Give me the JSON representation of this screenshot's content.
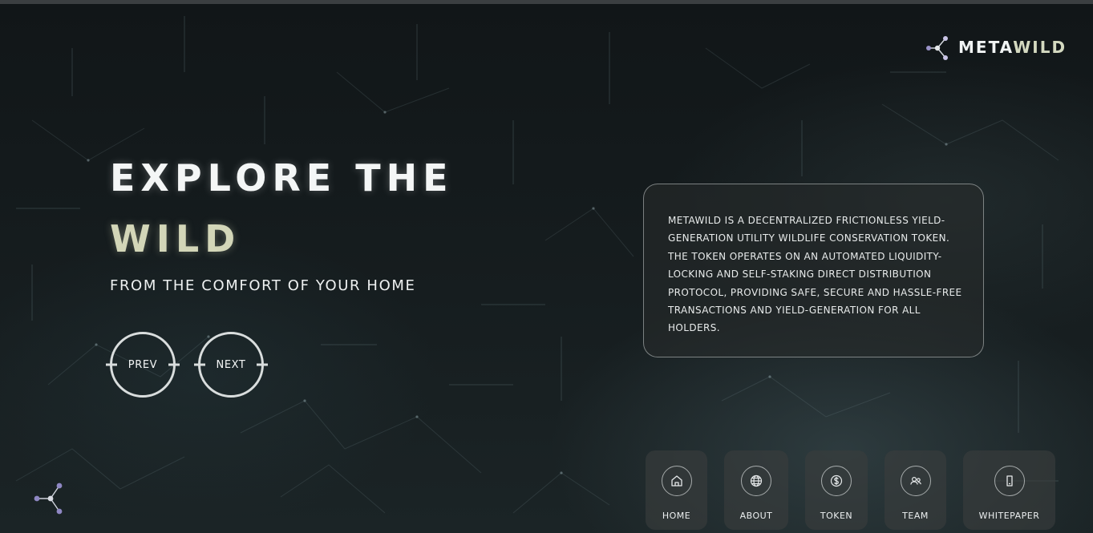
{
  "brand": {
    "name_main": "META",
    "name_accent": "WILD",
    "logo_icon": "network-nodes-icon"
  },
  "hero": {
    "title_line1": "EXPLORE THE",
    "title_line2": "WILD",
    "subtitle": "FROM THE COMFORT OF YOUR HOME",
    "prev_label": "PREV",
    "next_label": "NEXT"
  },
  "description": {
    "text": "METAWILD IS A DECENTRALIZED FRICTIONLESS YIELD-GENERATION UTILITY WILDLIFE CONSERVATION TOKEN. THE TOKEN OPERATES ON AN AUTOMATED LIQUIDITY-LOCKING AND SELF-STAKING DIRECT DISTRIBUTION PROTOCOL, PROVIDING SAFE, SECURE AND HASSLE-FREE TRANSACTIONS AND YIELD-GENERATION FOR ALL HOLDERS."
  },
  "nav": {
    "items": [
      {
        "label": "HOME",
        "icon": "home-icon"
      },
      {
        "label": "ABOUT",
        "icon": "globe-icon"
      },
      {
        "label": "TOKEN",
        "icon": "dollar-coin-icon"
      },
      {
        "label": "TEAM",
        "icon": "users-icon"
      },
      {
        "label": "WHITEPAPER",
        "icon": "document-icon"
      }
    ]
  },
  "colors": {
    "background": "#111618",
    "text": "#f4f6f6",
    "accent": "#d3d6b8",
    "node_accent": "#9a93c9"
  }
}
